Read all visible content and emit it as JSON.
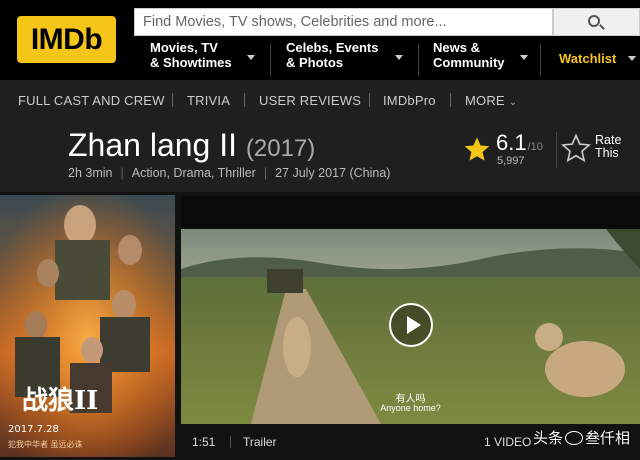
{
  "header": {
    "logo_text": "IMDb",
    "search_placeholder": "Find Movies, TV shows, Celebrities and more...",
    "nav": [
      {
        "label": "Movies, TV\n& Showtimes"
      },
      {
        "label": "Celebs, Events\n& Photos"
      },
      {
        "label": "News &\nCommunity"
      }
    ],
    "watchlist": "Watchlist"
  },
  "subnav": {
    "items": [
      "FULL CAST AND CREW",
      "TRIVIA",
      "USER REVIEWS",
      "IMDbPro",
      "MORE"
    ]
  },
  "title": {
    "name": "Zhan lang II",
    "year": "(2017)",
    "runtime": "2h 3min",
    "genres": "Action, Drama, Thriller",
    "release": "27 July 2017 (China)",
    "rating": "6.1",
    "rating_scale": "/10",
    "votes": "5,997",
    "rate_label": "Rate\nThis"
  },
  "poster": {
    "title_cn": "战狼II",
    "date": "2017.7.28",
    "slogan": "犯我中华者 虽远必诛"
  },
  "video": {
    "subtitle_cn": "有人吗",
    "subtitle_en": "Anyone home?",
    "duration": "1:51",
    "kind": "Trailer",
    "count": "1 VIDEO"
  },
  "watermark": {
    "text_left": "头条",
    "text_right": "叁仟相"
  },
  "colors": {
    "accent": "#f5c518",
    "background": "#121212",
    "subnav_bg": "#1f1f1f"
  }
}
